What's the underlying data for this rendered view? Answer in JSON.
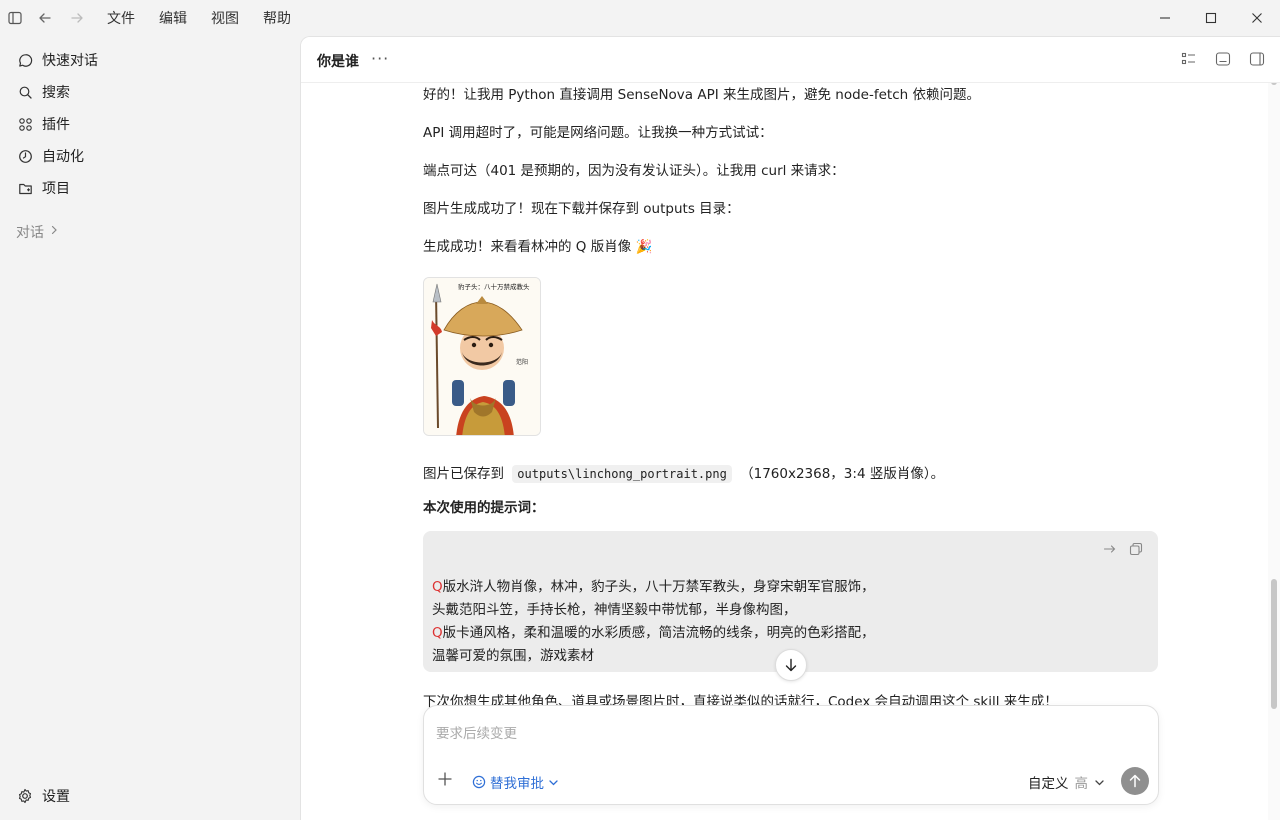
{
  "menu": [
    "文件",
    "编辑",
    "视图",
    "帮助"
  ],
  "sidebar": {
    "items": [
      {
        "label": "快速对话",
        "icon": "chat-bubble-icon"
      },
      {
        "label": "搜索",
        "icon": "search-icon"
      },
      {
        "label": "插件",
        "icon": "grid-icon"
      },
      {
        "label": "自动化",
        "icon": "clock-icon"
      },
      {
        "label": "项目",
        "icon": "folder-icon"
      }
    ],
    "section_label": "对话",
    "settings_label": "设置"
  },
  "header": {
    "title": "你是谁",
    "more": "···"
  },
  "messages": {
    "m1": "好的！让我用 Python 直接调用 SenseNova API 来生成图片，避免 node-fetch 依赖问题。",
    "m2": "API 调用超时了，可能是网络问题。让我换一种方式试试：",
    "m3": "端点可达（401 是预期的，因为没有发认证头）。让我用 curl 来请求：",
    "m4": "图片生成成功了！现在下载并保存到 outputs 目录：",
    "m5": "生成成功！来看看林冲的 Q 版肖像 🎉",
    "saved_prefix": "图片已保存到",
    "saved_path": "outputs\\linchong_portrait.png",
    "saved_suffix": "（1760x2368，3:4 竖版肖像）。",
    "prompt_heading": "本次使用的提示词：",
    "m6": "下次你想生成其他角色、道具或场景图片时，直接说类似的话就行，Codex 会自动调用这个 skill 来生成！"
  },
  "portrait": {
    "banner": "豹子头：八十万禁成教头",
    "side_label": "范阳"
  },
  "prompt_lines": [
    {
      "q": "Q",
      "text": "版水浒人物肖像，林冲，豹子头，八十万禁军教头，身穿宋朝军官服饰，"
    },
    {
      "q": "",
      "text": "头戴范阳斗笠，手持长枪，神情坚毅中带忧郁，半身像构图，"
    },
    {
      "q": "Q",
      "text": "版卡通风格，柔和温暖的水彩质感，简洁流畅的线条，明亮的色彩搭配，"
    },
    {
      "q": "",
      "text": "温馨可爱的氛围，游戏素材"
    }
  ],
  "composer": {
    "placeholder": "要求后续变更",
    "approval_label": "替我审批",
    "mode_label": "自定义",
    "level_label": "高"
  }
}
